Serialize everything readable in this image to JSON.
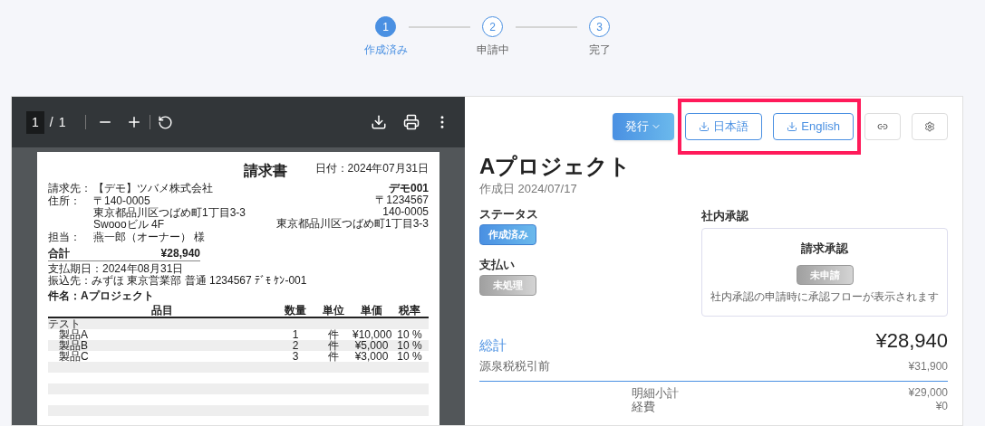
{
  "stepper": [
    {
      "number": "1",
      "label": "作成済み",
      "selected": true
    },
    {
      "number": "2",
      "label": "申請中",
      "selected": false
    },
    {
      "number": "3",
      "label": "完了",
      "selected": false
    }
  ],
  "viewer": {
    "page_current": "1",
    "page_separator": "/",
    "page_total": "1"
  },
  "document": {
    "title": "請求書",
    "date": "日付：2024年07月31日",
    "fields": [
      {
        "label": "請求先：",
        "lines": [
          "【デモ】ツバメ株式会社"
        ]
      },
      {
        "label": "住所：",
        "lines": [
          "〒140-0005",
          "東京都品川区つばめ町1丁目3-3",
          "Swoooビル 4F"
        ]
      },
      {
        "label": "担当：",
        "lines": [
          "燕一郎（オーナー） 様"
        ]
      }
    ],
    "issuer": [
      "デモ001",
      "〒1234567",
      "140-0005",
      "東京都品川区つばめ町1丁目3-3"
    ],
    "total_label": "合計",
    "total_value": "¥28,940",
    "notes": [
      "支払期日：2024年08月31日",
      "振込先：みずほ 東京営業部 普通 1234567 ﾃﾞﾓ ｹﾝ-001"
    ],
    "subject": "件名：Aプロジェクト",
    "table": {
      "columns": [
        "品目",
        "数量",
        "単位",
        "単価",
        "税率"
      ],
      "rows": [
        {
          "kind": "group",
          "cells": [
            "テスト"
          ]
        },
        {
          "kind": "item",
          "cells": [
            "製品A",
            "1",
            "件",
            "¥10,000",
            "10 %"
          ]
        },
        {
          "kind": "item",
          "cells": [
            "製品B",
            "2",
            "件",
            "¥5,000",
            "10 %"
          ]
        },
        {
          "kind": "item",
          "cells": [
            "製品C",
            "3",
            "件",
            "¥3,000",
            "10 %"
          ]
        },
        {
          "kind": "empty",
          "cells": []
        },
        {
          "kind": "empty",
          "cells": []
        },
        {
          "kind": "empty",
          "cells": []
        },
        {
          "kind": "empty",
          "cells": []
        },
        {
          "kind": "empty",
          "cells": []
        },
        {
          "kind": "empty",
          "cells": []
        }
      ]
    }
  },
  "actions": {
    "issue": "発行",
    "downloads": [
      "日本語",
      "English"
    ]
  },
  "project": {
    "title": "Aプロジェクト",
    "created": "作成日 2024/07/17",
    "status": {
      "label": "ステータス",
      "badge": "作成済み",
      "kind": "active"
    },
    "payment": {
      "label": "支払い",
      "badge": "未処理",
      "kind": "inactive"
    },
    "approval": {
      "label": "社内承認",
      "title": "請求承認",
      "badge": "未申請",
      "kind": "inactive",
      "note": "社内承認の申請時に承認フローが表示されます"
    }
  },
  "totals": {
    "grand_label": "総計",
    "grand_value": "¥28,940",
    "before_tax_label": "源泉税税引前",
    "before_tax_value": "¥31,900",
    "lines": [
      {
        "label": "明細小計",
        "value": "¥29,000"
      },
      {
        "label": "経費",
        "value": "¥0"
      }
    ]
  }
}
